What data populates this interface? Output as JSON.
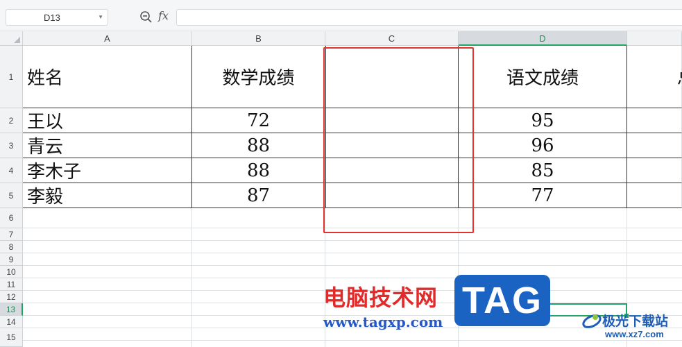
{
  "toolbar": {
    "cell_reference": "D13",
    "fx_label": "fx",
    "formula_value": ""
  },
  "columns": [
    "A",
    "B",
    "C",
    "D",
    ""
  ],
  "rows": [
    "1",
    "2",
    "3",
    "4",
    "5",
    "6",
    "7",
    "8",
    "9",
    "10",
    "11",
    "12",
    "13",
    "14",
    "15"
  ],
  "sheet": {
    "headers": {
      "name": "姓名",
      "math": "数学成绩",
      "blank": "",
      "chinese": "语文成绩",
      "partial": "总"
    },
    "records": [
      {
        "name": "王以",
        "math": "72",
        "chinese": "95"
      },
      {
        "name": "青云",
        "math": "88",
        "chinese": "96"
      },
      {
        "name": "李木子",
        "math": "88",
        "chinese": "85"
      },
      {
        "name": "李毅",
        "math": "87",
        "chinese": "77"
      }
    ]
  },
  "selection": {
    "active_cell": "D13",
    "active_column": "D",
    "active_row": "13"
  },
  "highlight": {
    "color": "#e0342f",
    "target_column": "C"
  },
  "watermark": {
    "site_name_cn": "电脑技术网",
    "site_url": "www.tagxp.com",
    "tag_text": "TAG",
    "partner_name_cn": "极光下载站",
    "partner_url": "www.xz7.com"
  },
  "colors": {
    "accent_green": "#21a366",
    "header_bg": "#f1f2f3",
    "tag_blue": "#1b63c2",
    "watermark_red": "#e12b2b"
  }
}
